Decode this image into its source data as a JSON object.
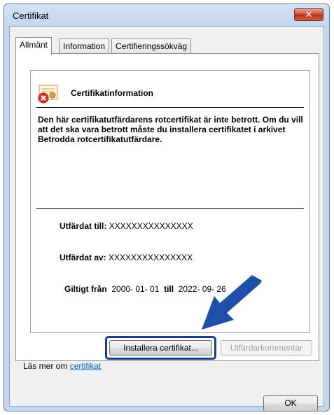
{
  "window": {
    "title": "Certifikat",
    "close_label": "✕"
  },
  "tabs": [
    {
      "label": "Allmänt",
      "active": true
    },
    {
      "label": "Information",
      "active": false
    },
    {
      "label": "Certifieringssökväg",
      "active": false
    }
  ],
  "cert": {
    "heading": "Certifikatinformation",
    "warning": "Den här certifikatutfärdarens rotcertifikat är inte betrott. Om du vill att det ska vara betrott måste du installera certifikatet i arkivet Betrodda rotcertifikatutfärdare.",
    "issued_to_label": "Utfärdat till:",
    "issued_to_value": "XXXXXXXXXXXXXXX",
    "issued_by_label": "Utfärdat av:",
    "issued_by_value": "XXXXXXXXXXXXXXX",
    "valid_from_label": "Giltigt från",
    "valid_from_value": "2000- 01- 01",
    "valid_to_label": "till",
    "valid_to_value": "2022- 09- 26"
  },
  "buttons": {
    "install": "Installera certifikat...",
    "issuer_statement": "Utfärdarkommentar",
    "ok": "OK"
  },
  "learn_more": {
    "prefix": "Läs mer om ",
    "link": "certifikat"
  },
  "colors": {
    "highlight": "#1c3f8c",
    "arrow": "#1f4fa8",
    "link": "#0066cc"
  }
}
